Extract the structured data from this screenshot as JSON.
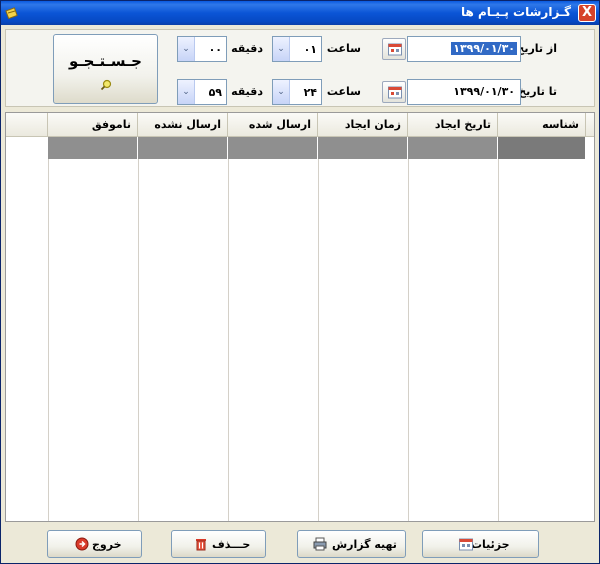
{
  "window": {
    "title": "گـزارشات پـیـام ها",
    "close_glyph": "X"
  },
  "search": {
    "button_label": "جـسـتـجـو"
  },
  "from": {
    "date_label": "از تاریخ :",
    "date_value": "۱۳۹۹/۰۱/۳۰",
    "hour_label": "ساعت :",
    "hour_value": "۰۱",
    "minute_label": "دقیقه :",
    "minute_value": "۰۰"
  },
  "to": {
    "date_label": "تا تاریخ :",
    "date_value": "۱۳۹۹/۰۱/۳۰",
    "hour_label": "ساعت :",
    "hour_value": "۲۴",
    "minute_label": "دقیقه :",
    "minute_value": "۵۹"
  },
  "table": {
    "columns": [
      "شناسه",
      "تاریخ ایجاد",
      "زمان ایجاد",
      "ارسال شده",
      "ارسال نشده",
      "ناموفق"
    ]
  },
  "footer": {
    "details_label": "جزئیات",
    "report_label": "تهیه گزارش",
    "delete_label": "حـــذف",
    "exit_label": "خروج"
  },
  "colors": {
    "title_bar": "#0a5ae0",
    "selected_row": "#8f8f8f",
    "selected_cell": "#7a7a7a"
  },
  "icons": {
    "window": "app-icon",
    "close": "close-icon",
    "search": "magnifier-icon",
    "calendar": "calendar-icon",
    "dropdown": "chevron-down-icon",
    "details": "calendar-icon",
    "report": "printer-icon",
    "delete": "trash-icon",
    "exit": "exit-icon"
  }
}
